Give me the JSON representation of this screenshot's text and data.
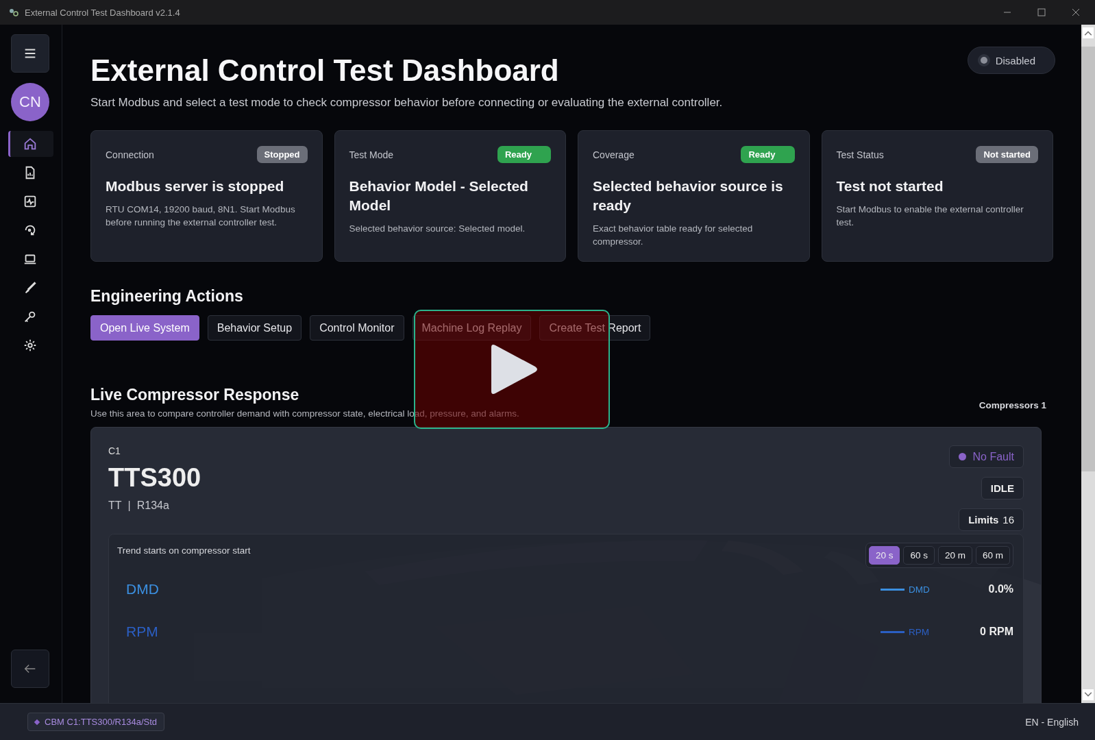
{
  "window": {
    "title": "External Control Test Dashboard v2.1.4"
  },
  "sidebar": {
    "avatar": "CN",
    "items": [
      {
        "kind": "home",
        "selected": true
      },
      {
        "kind": "report",
        "selected": false
      },
      {
        "kind": "activity",
        "selected": false
      },
      {
        "kind": "cycle",
        "selected": false
      },
      {
        "kind": "laptop",
        "selected": false
      },
      {
        "kind": "brush",
        "selected": false
      },
      {
        "kind": "key",
        "selected": false
      },
      {
        "kind": "settings",
        "selected": false
      }
    ]
  },
  "header": {
    "title": "External Control Test Dashboard",
    "subtitle": "Start Modbus and select a test mode to check compressor behavior before connecting or evaluating the external controller.",
    "toggle": {
      "label": "Disabled",
      "on": false
    }
  },
  "cards": [
    {
      "label": "Connection",
      "badge": "Stopped",
      "kind": "neutral",
      "title": "Modbus server is stopped",
      "text": "RTU COM14, 19200 baud, 8N1. Start Modbus before running the external controller test."
    },
    {
      "label": "Test Mode",
      "badge": "Ready",
      "kind": "ok",
      "title": "Behavior Model - Selected Model",
      "text": "Selected behavior source: Selected model."
    },
    {
      "label": "Coverage",
      "badge": "Ready",
      "kind": "ok",
      "title": "Selected behavior source is ready",
      "text": "Exact behavior table ready for selected compressor."
    },
    {
      "label": "Test Status",
      "badge": "Not started",
      "kind": "neutral",
      "title": "Test not started",
      "text": "Start Modbus to enable the external controller test."
    }
  ],
  "actions": {
    "title": "Engineering Actions",
    "buttons": [
      {
        "label": "Open Live System",
        "selected": true
      },
      {
        "label": "Behavior Setup",
        "selected": false
      },
      {
        "label": "Control Monitor",
        "selected": false
      },
      {
        "label": "Machine Log Replay",
        "selected": false
      },
      {
        "label": "Create Test Report",
        "selected": false
      }
    ]
  },
  "live": {
    "title": "Live Compressor Response",
    "subtitle": "Use this area to compare controller demand with compressor state, electrical load, pressure, and alarms.",
    "count": "Compressors 1",
    "compressor": {
      "id": "C1",
      "model": "TTS300",
      "type": "TT",
      "separator": "|",
      "refrigerant": "R134a",
      "fault": {
        "label": "No Fault",
        "color": "#8a63c9"
      },
      "state": "IDLE",
      "limits_label": "Limits",
      "limits": "16",
      "trend": {
        "title": "Trend starts on compressor start",
        "ranges": [
          {
            "label": "20 s",
            "selected": true
          },
          {
            "label": "60 s",
            "selected": false
          },
          {
            "label": "20 m",
            "selected": false
          },
          {
            "label": "60 m",
            "selected": false
          }
        ],
        "series": [
          {
            "name": "DMD",
            "legend": "DMD",
            "color": "#3b8fe0",
            "value": "0.0%"
          },
          {
            "name": "RPM",
            "legend": "RPM",
            "color": "#2b5fc4",
            "value": "0 RPM"
          }
        ]
      }
    }
  },
  "video_overlay": {
    "shown": true
  },
  "status_bar": {
    "tag": "CBM C1:TTS300/R134a/Std",
    "language": "EN - English"
  }
}
